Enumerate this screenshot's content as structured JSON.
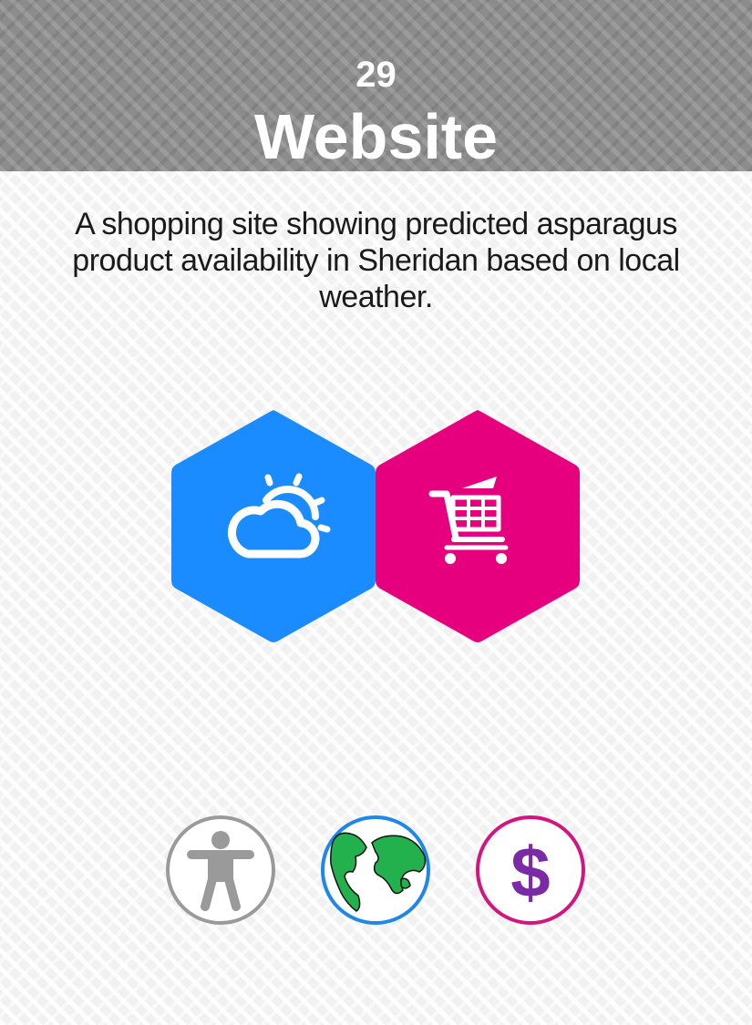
{
  "card": {
    "number": "29",
    "title": "Website",
    "description": "A shopping site showing predicted asparagus product availability in Sheridan based on local weather."
  },
  "hexagons": [
    {
      "icon": "weather-partly-cloudy-icon",
      "color": "#1a8cff"
    },
    {
      "icon": "shopping-cart-icon",
      "color": "#e6007e"
    }
  ],
  "bottom_icons": [
    {
      "icon": "accessibility-icon",
      "color": "#9a9a9a"
    },
    {
      "icon": "globe-icon",
      "color": "#1f87e8"
    },
    {
      "icon": "dollar-icon",
      "color": "#d4147f"
    }
  ]
}
